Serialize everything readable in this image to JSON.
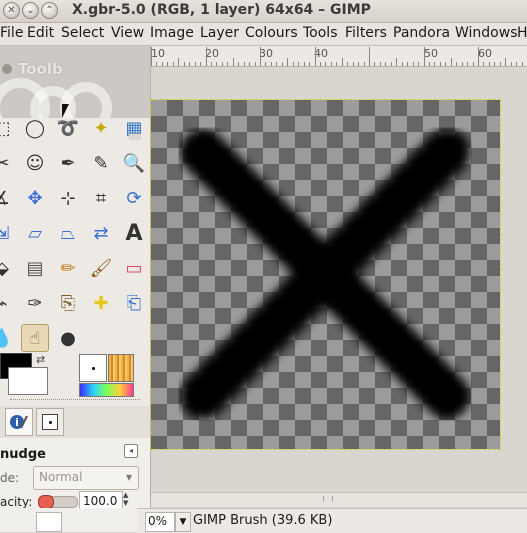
{
  "window": {
    "title": "X.gbr-5.0 (RGB, 1 layer) 64x64 – GIMP"
  },
  "menubar": {
    "items": [
      "File",
      "Edit",
      "Select",
      "View",
      "Image",
      "Layer",
      "Colours",
      "Tools",
      "Filters",
      "Pandora",
      "Windows",
      "H"
    ]
  },
  "toolbox": {
    "title": "Toolb",
    "tools": [
      "rect-select-icon",
      "ellipse-select-icon",
      "lasso-icon",
      "fuzzy-select-icon",
      "select-by-color-icon",
      "scissors-icon",
      "foreground-select-icon",
      "paths-icon",
      "color-picker-icon",
      "zoom-icon",
      "measure-icon",
      "move-icon",
      "align-icon",
      "crop-icon",
      "rotate-icon",
      "scale-icon",
      "shear-icon",
      "perspective-icon",
      "flip-icon",
      "text-icon",
      "bucket-fill-icon",
      "blend-icon",
      "pencil-icon",
      "paintbrush-icon",
      "eraser-icon",
      "airbrush-icon",
      "ink-icon",
      "clone-icon",
      "heal-icon",
      "perspective-clone-icon",
      "blur-icon",
      "smudge-icon",
      "dodge-burn-icon"
    ],
    "foreground_color": "#000000",
    "background_color": "#ffffff"
  },
  "tool_options": {
    "title": "nudge",
    "mode_label": "de:",
    "mode_value": "Normal",
    "opacity_label": "acity:",
    "opacity_value": "100.0"
  },
  "ruler": {
    "labels": [
      "10",
      "20",
      "30",
      "40",
      "50",
      "60"
    ]
  },
  "canvas": {
    "content": "X brush shape",
    "selection_color": "#d8cf28"
  },
  "statusbar": {
    "zoom": "0%",
    "info": "GIMP Brush (39.6 KB)"
  }
}
